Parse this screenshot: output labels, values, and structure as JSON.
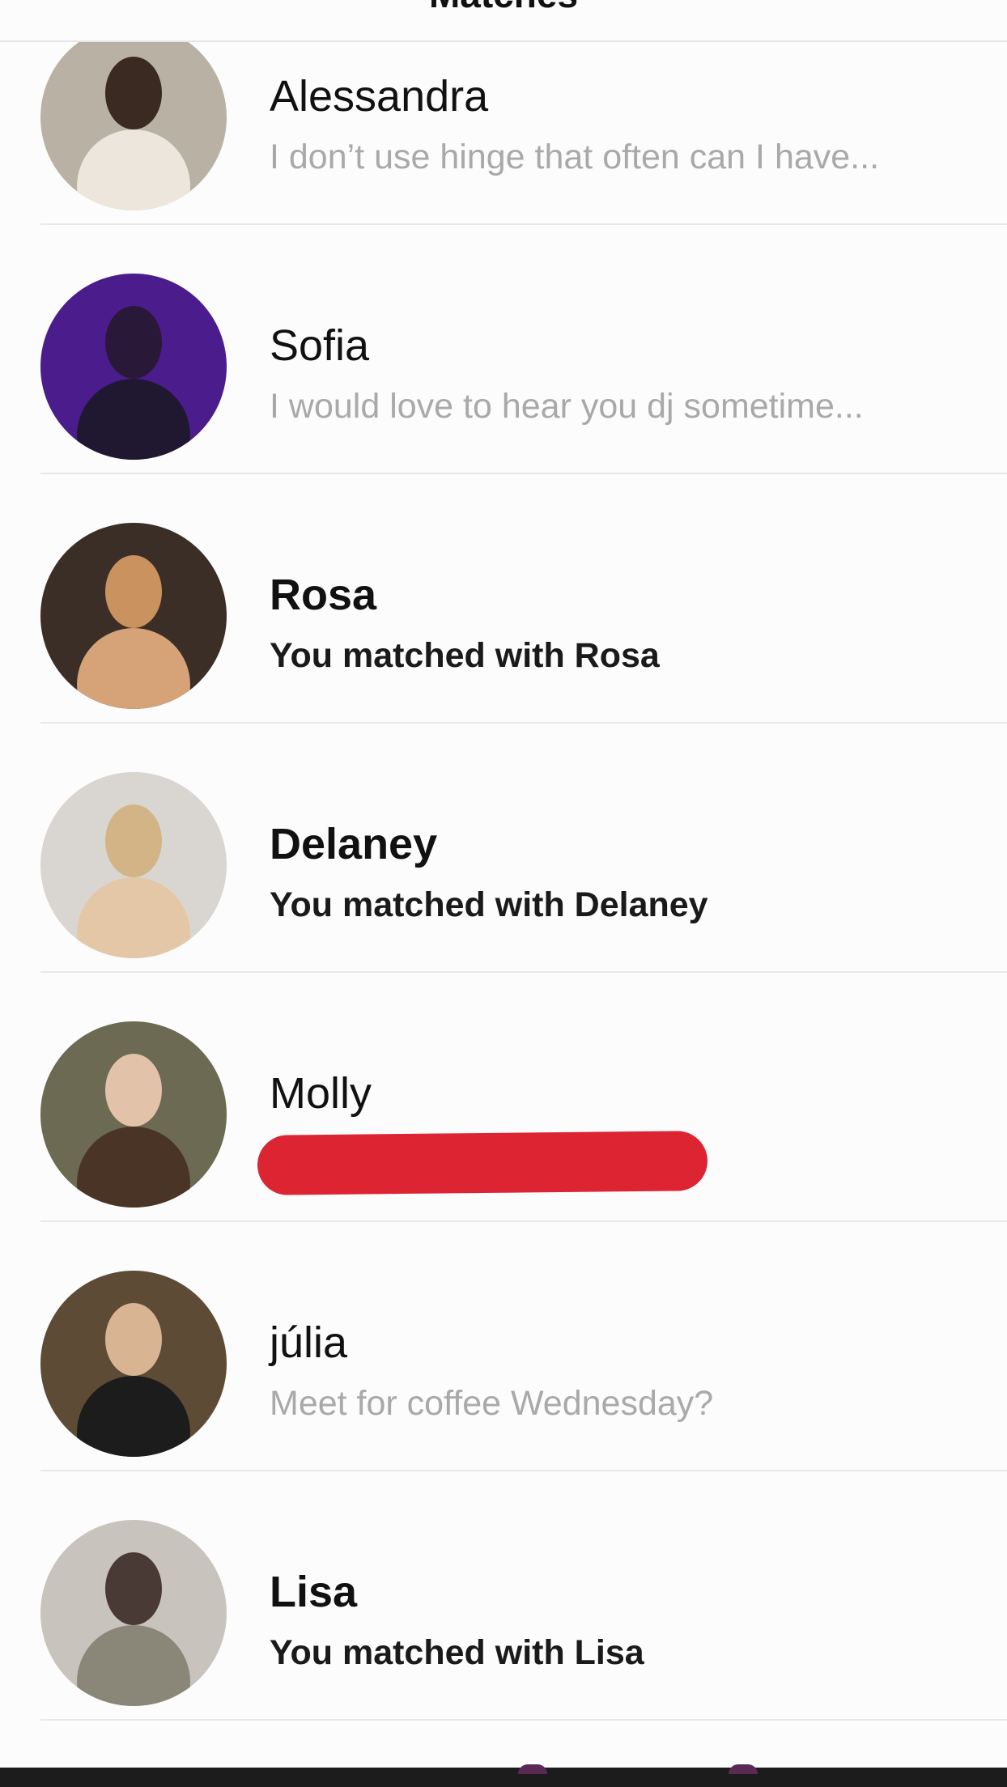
{
  "header": {
    "title": "Matches"
  },
  "matches": [
    {
      "name": "Alessandra",
      "subtitle": "I don’t use hinge that often can I have...",
      "kind": "preview",
      "avatar_colors": {
        "bg": "#b9b2a4",
        "head": "#3a2a22",
        "body": "#ece6dc"
      }
    },
    {
      "name": "Sofia",
      "subtitle": "I would love to hear you dj sometime...",
      "kind": "preview",
      "avatar_colors": {
        "bg": "#4b1c8c",
        "head": "#2a1838",
        "body": "#201830"
      }
    },
    {
      "name": "Rosa",
      "subtitle": "You matched with Rosa",
      "kind": "matched",
      "avatar_colors": {
        "bg": "#3a2e26",
        "head": "#c9925e",
        "body": "#d6a277"
      }
    },
    {
      "name": "Delaney",
      "subtitle": "You matched with Delaney",
      "kind": "matched",
      "avatar_colors": {
        "bg": "#d9d6d2",
        "head": "#d3b487",
        "body": "#e4c7a6"
      }
    },
    {
      "name": "Molly",
      "subtitle": "",
      "kind": "redacted",
      "avatar_colors": {
        "bg": "#6c6a52",
        "head": "#e3c2aa",
        "body": "#4a3426"
      }
    },
    {
      "name": "júlia",
      "subtitle": "Meet for coffee Wednesday?",
      "kind": "preview",
      "avatar_colors": {
        "bg": "#5e4b36",
        "head": "#d9b493",
        "body": "#1c1c1c"
      }
    },
    {
      "name": "Lisa",
      "subtitle": "You matched with Lisa",
      "kind": "matched",
      "avatar_colors": {
        "bg": "#c8c4bd",
        "head": "#4a3a36",
        "body": "#8a8678"
      }
    }
  ],
  "colors": {
    "redaction": "#dc2433",
    "preview_text": "#a9a9a9",
    "matched_text": "#1a1a1a",
    "divider": "#e8e8e8"
  }
}
